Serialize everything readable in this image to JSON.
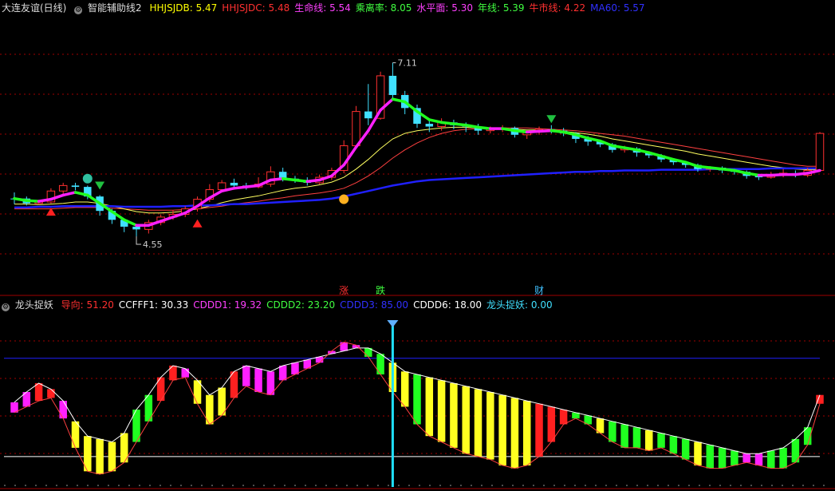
{
  "main_header": {
    "stock": "大连友谊(日线)",
    "indicator": "智能辅助线2",
    "items": [
      {
        "label": "HHJSJDB: 5.47",
        "color": "#ffff00"
      },
      {
        "label": "HHJSJDC: 5.48",
        "color": "#ff3030"
      },
      {
        "label": "生命线: 5.54",
        "color": "#ff40ff"
      },
      {
        "label": "乘离率: 8.05",
        "color": "#40ff40"
      },
      {
        "label": "水平面: 5.30",
        "color": "#ff40ff"
      },
      {
        "label": "年线: 5.39",
        "color": "#40ff40"
      },
      {
        "label": "牛市线: 4.22",
        "color": "#ff3030"
      },
      {
        "label": "MA60: 5.57",
        "color": "#3030ff"
      }
    ]
  },
  "sub_header": {
    "indicator": "龙头捉妖",
    "items": [
      {
        "label": "导向: 51.20",
        "color": "#ff3030"
      },
      {
        "label": "CCFFF1: 30.33",
        "color": "#ffffff"
      },
      {
        "label": "CDDD1: 19.32",
        "color": "#ff40ff"
      },
      {
        "label": "CDDD2: 23.20",
        "color": "#40ff40"
      },
      {
        "label": "CDDD3: 85.00",
        "color": "#3030ff"
      },
      {
        "label": "CDDD6: 18.00",
        "color": "#ffffff"
      },
      {
        "label": "龙头捉妖: 0.00",
        "color": "#40e0ff"
      }
    ]
  },
  "annotations": {
    "high": "7.11",
    "low": "4.55"
  },
  "signal_labels": [
    {
      "text": "涨",
      "index": 27,
      "color": "#ff3030"
    },
    {
      "text": "跌",
      "index": 30,
      "color": "#40ff40"
    },
    {
      "text": "财",
      "index": 43,
      "color": "#40c0ff"
    }
  ],
  "colors": {
    "up": "#ff3030",
    "down": "#40e0ff",
    "ma60": "#2020ff",
    "pink": "#ff20ff",
    "green": "#20ff20",
    "yellow": "#ffff20",
    "cyan": "#20e0ff",
    "grid": "#a00000"
  },
  "chart_data": [
    {
      "type": "candlestick",
      "title": "大连友谊(日线)",
      "annotations": [
        {
          "label": "7.11",
          "value": 7.11
        },
        {
          "label": "4.55",
          "value": 4.55
        }
      ],
      "candles": [
        [
          5.13,
          5.12,
          5.22,
          5.05
        ],
        [
          5.13,
          5.06,
          5.16,
          5.03
        ],
        [
          5.06,
          5.08,
          5.1,
          5.04
        ],
        [
          5.08,
          5.24,
          5.28,
          5.06
        ],
        [
          5.24,
          5.32,
          5.36,
          5.2
        ],
        [
          5.32,
          5.3,
          5.36,
          5.25
        ],
        [
          5.3,
          5.16,
          5.32,
          5.12
        ],
        [
          5.16,
          4.95,
          5.18,
          4.88
        ],
        [
          4.95,
          4.82,
          4.98,
          4.76
        ],
        [
          4.82,
          4.72,
          4.84,
          4.64
        ],
        [
          4.72,
          4.68,
          4.76,
          4.58
        ],
        [
          4.68,
          4.78,
          4.82,
          4.62
        ],
        [
          4.78,
          4.86,
          4.9,
          4.74
        ],
        [
          4.86,
          4.9,
          4.96,
          4.82
        ],
        [
          4.9,
          4.98,
          5.02,
          4.86
        ],
        [
          4.98,
          5.12,
          5.16,
          4.94
        ],
        [
          5.12,
          5.26,
          5.34,
          5.08
        ],
        [
          5.26,
          5.36,
          5.4,
          5.22
        ],
        [
          5.36,
          5.32,
          5.42,
          5.28
        ],
        [
          5.32,
          5.3,
          5.36,
          5.26
        ],
        [
          5.3,
          5.34,
          5.44,
          5.28
        ],
        [
          5.34,
          5.52,
          5.6,
          5.3
        ],
        [
          5.52,
          5.42,
          5.58,
          5.38
        ],
        [
          5.42,
          5.4,
          5.46,
          5.36
        ],
        [
          5.4,
          5.36,
          5.44,
          5.32
        ],
        [
          5.36,
          5.44,
          5.48,
          5.34
        ],
        [
          5.44,
          5.54,
          5.58,
          5.4
        ],
        [
          5.54,
          5.9,
          5.98,
          5.5
        ],
        [
          5.9,
          6.4,
          6.48,
          5.86
        ],
        [
          6.4,
          6.3,
          6.8,
          6.2
        ],
        [
          6.3,
          6.92,
          6.98,
          6.28
        ],
        [
          6.92,
          6.64,
          7.11,
          6.58
        ],
        [
          6.64,
          6.45,
          6.7,
          6.36
        ],
        [
          6.45,
          6.22,
          6.5,
          6.16
        ],
        [
          6.22,
          6.18,
          6.28,
          6.1
        ],
        [
          6.18,
          6.24,
          6.3,
          6.12
        ],
        [
          6.24,
          6.2,
          6.28,
          6.14
        ],
        [
          6.2,
          6.18,
          6.24,
          6.1
        ],
        [
          6.18,
          6.12,
          6.22,
          6.06
        ],
        [
          6.12,
          6.14,
          6.18,
          6.08
        ],
        [
          6.14,
          6.16,
          6.2,
          6.1
        ],
        [
          6.16,
          6.06,
          6.18,
          6.02
        ],
        [
          6.06,
          6.1,
          6.12,
          6.0
        ],
        [
          6.1,
          6.14,
          6.18,
          6.06
        ],
        [
          6.14,
          6.12,
          6.2,
          6.08
        ],
        [
          6.12,
          6.08,
          6.16,
          6.04
        ],
        [
          6.08,
          6.0,
          6.1,
          5.94
        ],
        [
          6.0,
          5.96,
          6.04,
          5.9
        ],
        [
          5.96,
          5.92,
          5.98,
          5.88
        ],
        [
          5.92,
          5.84,
          5.94,
          5.8
        ],
        [
          5.84,
          5.86,
          5.9,
          5.8
        ],
        [
          5.86,
          5.8,
          5.88,
          5.74
        ],
        [
          5.8,
          5.76,
          5.82,
          5.72
        ],
        [
          5.76,
          5.7,
          5.78,
          5.66
        ],
        [
          5.7,
          5.66,
          5.72,
          5.62
        ],
        [
          5.66,
          5.62,
          5.68,
          5.58
        ],
        [
          5.62,
          5.56,
          5.64,
          5.52
        ],
        [
          5.56,
          5.58,
          5.6,
          5.52
        ],
        [
          5.58,
          5.54,
          5.6,
          5.5
        ],
        [
          5.54,
          5.52,
          5.56,
          5.48
        ],
        [
          5.52,
          5.46,
          5.54,
          5.42
        ],
        [
          5.46,
          5.44,
          5.48,
          5.4
        ],
        [
          5.44,
          5.48,
          5.52,
          5.42
        ],
        [
          5.48,
          5.5,
          5.56,
          5.44
        ],
        [
          5.5,
          5.47,
          5.54,
          5.44
        ],
        [
          5.47,
          5.54,
          5.58,
          5.44
        ],
        [
          5.54,
          6.08,
          6.1,
          5.52
        ]
      ],
      "ma60": [
        5.0,
        5.0,
        5.01,
        5.01,
        5.02,
        5.02,
        5.02,
        5.02,
        5.02,
        5.01,
        5.01,
        5.01,
        5.01,
        5.02,
        5.02,
        5.03,
        5.03,
        5.04,
        5.05,
        5.05,
        5.06,
        5.07,
        5.08,
        5.09,
        5.1,
        5.11,
        5.13,
        5.16,
        5.2,
        5.24,
        5.28,
        5.32,
        5.35,
        5.38,
        5.4,
        5.41,
        5.42,
        5.43,
        5.44,
        5.45,
        5.46,
        5.47,
        5.48,
        5.49,
        5.5,
        5.51,
        5.52,
        5.52,
        5.53,
        5.53,
        5.54,
        5.54,
        5.54,
        5.55,
        5.55,
        5.55,
        5.55,
        5.56,
        5.56,
        5.56,
        5.56,
        5.56,
        5.57,
        5.57,
        5.57,
        5.57,
        5.57
      ],
      "life_line": [
        5.13,
        5.1,
        5.09,
        5.12,
        5.18,
        5.22,
        5.18,
        5.06,
        4.94,
        4.82,
        4.74,
        4.74,
        4.8,
        4.86,
        4.92,
        5.02,
        5.14,
        5.24,
        5.28,
        5.3,
        5.32,
        5.4,
        5.42,
        5.4,
        5.38,
        5.4,
        5.46,
        5.62,
        5.88,
        6.12,
        6.42,
        6.58,
        6.54,
        6.4,
        6.28,
        6.24,
        6.22,
        6.2,
        6.17,
        6.15,
        6.15,
        6.12,
        6.1,
        6.11,
        6.12,
        6.1,
        6.06,
        6.01,
        5.97,
        5.9,
        5.87,
        5.84,
        5.8,
        5.75,
        5.7,
        5.66,
        5.6,
        5.58,
        5.56,
        5.54,
        5.5,
        5.47,
        5.47,
        5.48,
        5.48,
        5.5,
        5.54
      ],
      "line_yellow": [
        5.05,
        5.05,
        5.04,
        5.05,
        5.06,
        5.08,
        5.08,
        5.06,
        5.02,
        4.98,
        4.94,
        4.92,
        4.92,
        4.93,
        4.95,
        4.98,
        5.02,
        5.07,
        5.11,
        5.14,
        5.17,
        5.21,
        5.25,
        5.28,
        5.3,
        5.33,
        5.37,
        5.44,
        5.56,
        5.7,
        5.86,
        6.0,
        6.08,
        6.12,
        6.14,
        6.16,
        6.17,
        6.17,
        6.16,
        6.16,
        6.15,
        6.14,
        6.13,
        6.13,
        6.12,
        6.11,
        6.09,
        6.07,
        6.04,
        6.0,
        5.97,
        5.94,
        5.91,
        5.88,
        5.85,
        5.82,
        5.78,
        5.75,
        5.72,
        5.69,
        5.66,
        5.63,
        5.6,
        5.58,
        5.56,
        5.55,
        5.55
      ],
      "line_red": [
        4.98,
        4.98,
        4.98,
        4.98,
        4.99,
        5.0,
        5.0,
        5.0,
        4.99,
        4.98,
        4.97,
        4.96,
        4.96,
        4.96,
        4.97,
        4.98,
        5.0,
        5.02,
        5.05,
        5.07,
        5.09,
        5.12,
        5.14,
        5.17,
        5.19,
        5.21,
        5.24,
        5.28,
        5.36,
        5.46,
        5.58,
        5.72,
        5.84,
        5.94,
        6.02,
        6.08,
        6.12,
        6.14,
        6.15,
        6.16,
        6.16,
        6.16,
        6.16,
        6.15,
        6.14,
        6.13,
        6.12,
        6.1,
        6.08,
        6.06,
        6.04,
        6.01,
        5.98,
        5.95,
        5.92,
        5.89,
        5.86,
        5.83,
        5.8,
        5.77,
        5.74,
        5.71,
        5.68,
        5.65,
        5.62,
        5.6,
        5.6
      ]
    },
    {
      "type": "bar",
      "title": "龙头捉妖",
      "ylim": [
        0,
        105
      ],
      "reference_lines": [
        85,
        18
      ],
      "upper": [
        55,
        62,
        68,
        64,
        56,
        42,
        32,
        30,
        28,
        34,
        50,
        60,
        72,
        80,
        78,
        70,
        60,
        65,
        76,
        80,
        78,
        76,
        80,
        82,
        84,
        86,
        88,
        90,
        92,
        92,
        88,
        82,
        76,
        74,
        72,
        70,
        68,
        66,
        64,
        62,
        60,
        58,
        56,
        54,
        52,
        50,
        48,
        46,
        44,
        42,
        40,
        38,
        36,
        34,
        32,
        30,
        28,
        26,
        24,
        22,
        20,
        20,
        22,
        24,
        30,
        38,
        60
      ],
      "lower": [
        48,
        52,
        56,
        58,
        44,
        24,
        8,
        6,
        8,
        14,
        28,
        42,
        56,
        70,
        72,
        54,
        40,
        46,
        58,
        66,
        62,
        60,
        70,
        74,
        78,
        82,
        90,
        96,
        94,
        86,
        74,
        62,
        52,
        40,
        32,
        28,
        24,
        20,
        18,
        16,
        12,
        10,
        12,
        18,
        28,
        40,
        44,
        40,
        34,
        28,
        24,
        24,
        22,
        24,
        20,
        16,
        12,
        10,
        10,
        12,
        14,
        12,
        10,
        10,
        14,
        26,
        54
      ],
      "bar_colors": [
        "pink",
        "pink",
        "red",
        "red",
        "pink",
        "yellow",
        "yellow",
        "yellow",
        "yellow",
        "yellow",
        "green",
        "green",
        "red",
        "red",
        "pink",
        "yellow",
        "yellow",
        "yellow",
        "red",
        "pink",
        "pink",
        "pink",
        "pink",
        "pink",
        "pink",
        "pink",
        "pink",
        "pink",
        "pink",
        "green",
        "green",
        "yellow",
        "yellow",
        "green",
        "yellow",
        "yellow",
        "yellow",
        "yellow",
        "yellow",
        "yellow",
        "yellow",
        "yellow",
        "yellow",
        "red",
        "red",
        "red",
        "green",
        "green",
        "yellow",
        "green",
        "green",
        "green",
        "yellow",
        "green",
        "green",
        "green",
        "yellow",
        "green",
        "green",
        "green",
        "pink",
        "pink",
        "green",
        "green",
        "green",
        "green",
        "red"
      ],
      "signal_index": 31
    }
  ]
}
